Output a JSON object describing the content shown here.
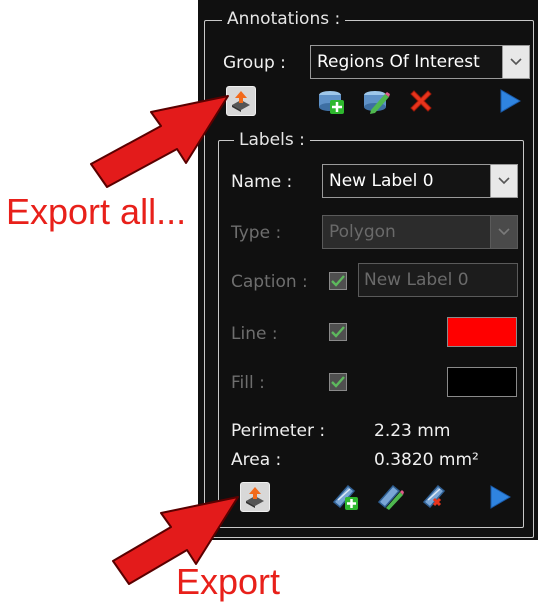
{
  "annotations": {
    "title": "Annotations :",
    "group_label": "Group :",
    "group_value": "Regions Of Interest",
    "toolbar": {
      "icons": [
        "export-all-icon",
        "add-group-icon",
        "edit-group-icon",
        "delete-group-icon",
        "play-icon"
      ]
    }
  },
  "labels": {
    "title": "Labels :",
    "name_label": "Name :",
    "name_value": "New Label 0",
    "type_label": "Type  :",
    "type_value": "Polygon",
    "caption_label": "Caption :",
    "caption_value": "New Label 0",
    "line_label": "Line :",
    "fill_label": "Fill :",
    "line_color": "#ff0000",
    "fill_color": "#000000",
    "perimeter_label": "Perimeter :",
    "perimeter_value": "2.23 mm",
    "area_label": "Area :",
    "area_value": "0.3820 mm²",
    "toolbar": {
      "icons": [
        "export-icon",
        "add-label-icon",
        "edit-label-icon",
        "delete-label-icon",
        "play-icon"
      ]
    }
  },
  "callouts": {
    "export_all": "Export all...",
    "export": "Export"
  },
  "colors": {
    "panel_bg": "#101010",
    "callout_red": "#e8201a",
    "arrow_red": "#e31b1b"
  }
}
